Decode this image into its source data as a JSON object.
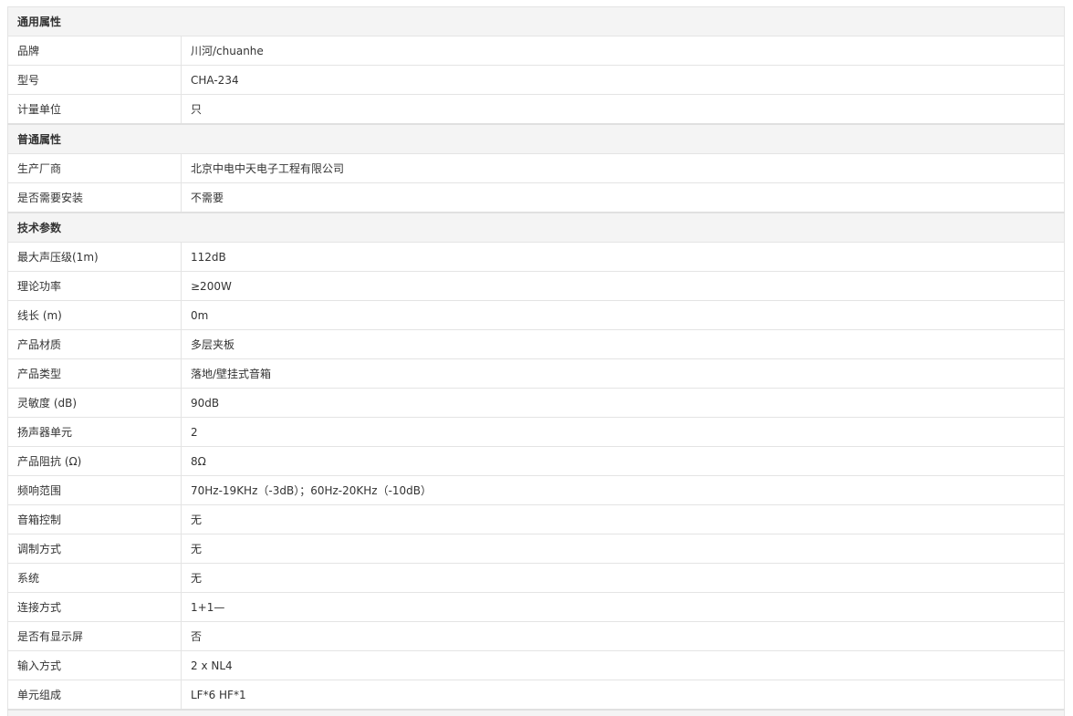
{
  "groups": [
    {
      "title": "通用属性",
      "rows": [
        {
          "name": "品牌",
          "value": "川河/chuanhe"
        },
        {
          "name": "型号",
          "value": "CHA-234"
        },
        {
          "name": "计量单位",
          "value": "只"
        }
      ]
    },
    {
      "title": "普通属性",
      "rows": [
        {
          "name": "生产厂商",
          "value": "北京中电中天电子工程有限公司"
        },
        {
          "name": "是否需要安装",
          "value": "不需要"
        }
      ]
    },
    {
      "title": "技术参数",
      "rows": [
        {
          "name": "最大声压级(1m)",
          "value": "112dB"
        },
        {
          "name": "理论功率",
          "value": "≥200W"
        },
        {
          "name": "线长 (m)",
          "value": "0m"
        },
        {
          "name": "产品材质",
          "value": "多层夹板"
        },
        {
          "name": "产品类型",
          "value": "落地/壁挂式音箱"
        },
        {
          "name": "灵敏度 (dB)",
          "value": "90dB"
        },
        {
          "name": "扬声器单元",
          "value": "2"
        },
        {
          "name": "产品阻抗 (Ω)",
          "value": "8Ω"
        },
        {
          "name": "频响范围",
          "value": "70Hz-19KHz（-3dB）；60Hz-20KHz（-10dB）"
        },
        {
          "name": "音箱控制",
          "value": "无"
        },
        {
          "name": "调制方式",
          "value": "无"
        },
        {
          "name": "系统",
          "value": "无"
        },
        {
          "name": "连接方式",
          "value": "1+1—"
        },
        {
          "name": "是否有显示屏",
          "value": "否"
        },
        {
          "name": "输入方式",
          "value": "2 x NL4"
        },
        {
          "name": "单元组成",
          "value": "LF*6 HF*1"
        }
      ]
    }
  ]
}
